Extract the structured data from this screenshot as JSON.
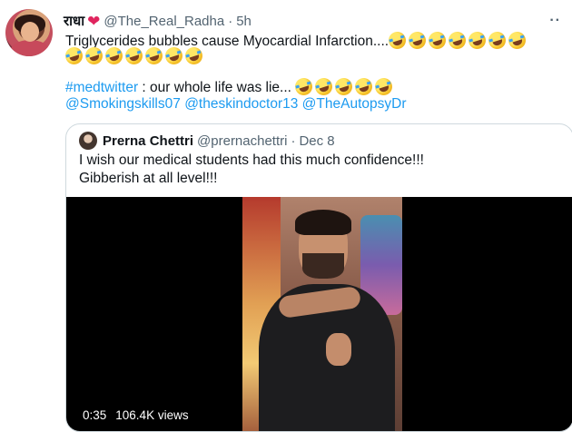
{
  "tweet": {
    "author_name": "राधा",
    "author_handle": "@The_Real_Radha",
    "separator": "·",
    "time": "5h",
    "more_icon": "more-dots-icon",
    "line1_text": "Triglycerides bubbles cause Myocardial Infarction....",
    "line1_emoji_count": 7,
    "line2_emoji_count": 7,
    "hashtag": "#medtwitter",
    "line3_text": " : our whole life was lie...",
    "line3_emoji_count": 5,
    "mentions": [
      "@Smokingskills07",
      "@theskindoctor13",
      "@TheAutopsyDr"
    ],
    "emoji_name": "rolling-on-floor-laughing-emoji",
    "heart_icon": "red-heart-emoji"
  },
  "quoted": {
    "author_name": "Prerna Chettri",
    "author_handle": "@prernachettri",
    "separator": "·",
    "date": "Dec 8",
    "text_line1": "I wish our medical students had this much confidence!!!",
    "text_line2": "Gibberish at all level!!!",
    "video": {
      "duration": "0:35",
      "views": "106.4K views"
    }
  },
  "colors": {
    "link": "#1d9bf0",
    "secondary_text": "#536471",
    "border": "#cfd9de",
    "heart": "#e0245e"
  }
}
